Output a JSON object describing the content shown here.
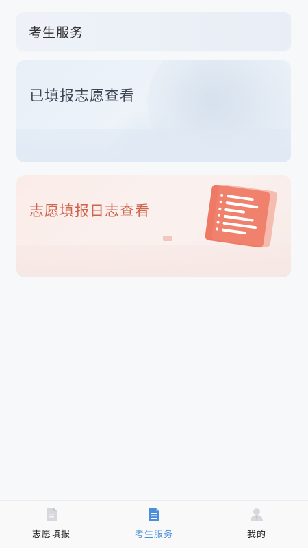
{
  "header": {
    "title": "考生服务"
  },
  "cards": [
    {
      "label": "已填报志愿查看"
    },
    {
      "label": "志愿填报日志查看"
    }
  ],
  "tabs": [
    {
      "label": "志愿填报",
      "icon": "document-icon",
      "active": false
    },
    {
      "label": "考生服务",
      "icon": "document-icon",
      "active": true
    },
    {
      "label": "我的",
      "icon": "person-icon",
      "active": false
    }
  ],
  "colors": {
    "accent": "#4a8fd8",
    "card_red_text": "#d0634a",
    "doc_illustration": "#ee7a66"
  }
}
